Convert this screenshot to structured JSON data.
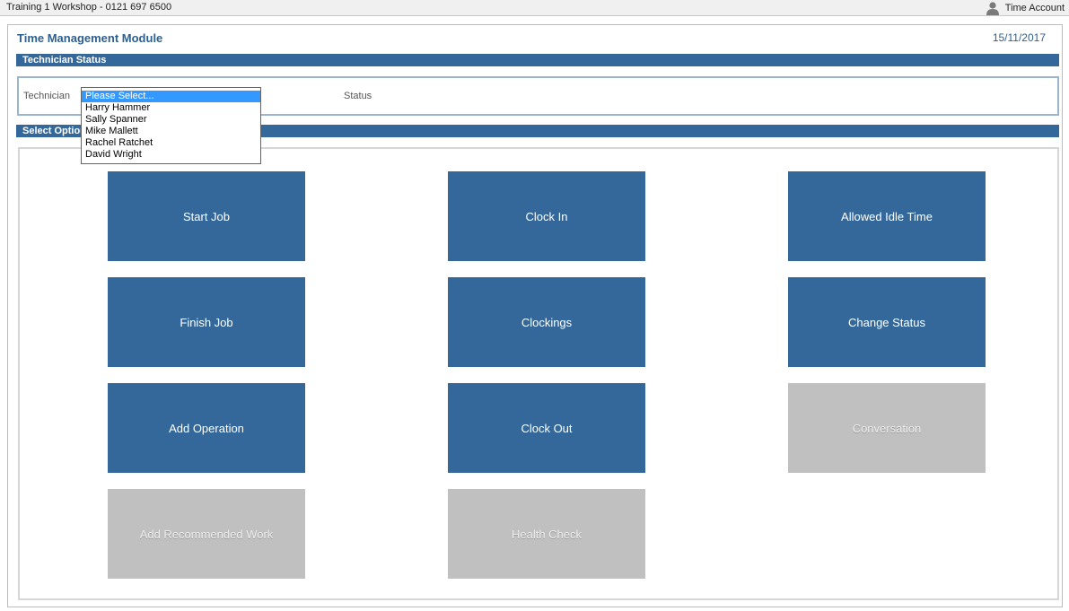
{
  "titlebar": {
    "title": "Training 1 Workshop - 0121 697 6500",
    "account_label": "Time Account",
    "account_icon": "user-icon"
  },
  "module": {
    "title": "Time Management Module",
    "date": "15/11/2017"
  },
  "technician_section": {
    "header": "Technician Status",
    "technician_label": "Technician",
    "status_label": "Status"
  },
  "technician_dropdown": {
    "selected": "Please Select...",
    "options": [
      "Please Select...",
      "Harry Hammer",
      "Sally Spanner",
      "Mike Mallett",
      "Rachel Ratchet",
      "David Wright"
    ]
  },
  "options_section": {
    "header": "Select Option",
    "buttons": [
      {
        "label": "Start Job",
        "enabled": true
      },
      {
        "label": "Clock In",
        "enabled": true
      },
      {
        "label": "Allowed Idle Time",
        "enabled": true
      },
      {
        "label": "Finish Job",
        "enabled": true
      },
      {
        "label": "Clockings",
        "enabled": true
      },
      {
        "label": "Change Status",
        "enabled": true
      },
      {
        "label": "Add Operation",
        "enabled": true
      },
      {
        "label": "Clock Out",
        "enabled": true
      },
      {
        "label": "Conversation",
        "enabled": false
      },
      {
        "label": "Add Recommended Work",
        "enabled": false
      },
      {
        "label": "Health Check",
        "enabled": false
      }
    ]
  },
  "colors": {
    "accent": "#34689a",
    "title_text": "#2e5f8f",
    "disabled_button": "#c0c0c0",
    "selection": "#3399ff"
  }
}
